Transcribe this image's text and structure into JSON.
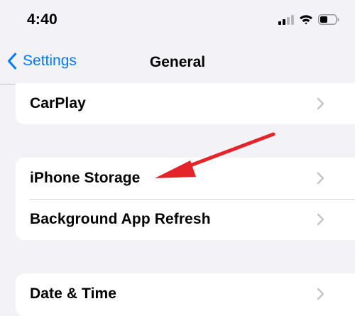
{
  "status_bar": {
    "time": "4:40",
    "icons": [
      "cellular-signal-icon",
      "wifi-icon",
      "battery-icon"
    ]
  },
  "nav": {
    "back_label": "Settings",
    "title": "General"
  },
  "groups": [
    {
      "rows": [
        {
          "label": "CarPlay"
        }
      ]
    },
    {
      "rows": [
        {
          "label": "iPhone Storage"
        },
        {
          "label": "Background App Refresh"
        }
      ]
    },
    {
      "rows": [
        {
          "label": "Date & Time"
        }
      ]
    }
  ],
  "colors": {
    "accent": "#007aff",
    "background": "#f2f2f7",
    "annotation_arrow": "#e5242a",
    "chevron": "#c4c4c6"
  }
}
